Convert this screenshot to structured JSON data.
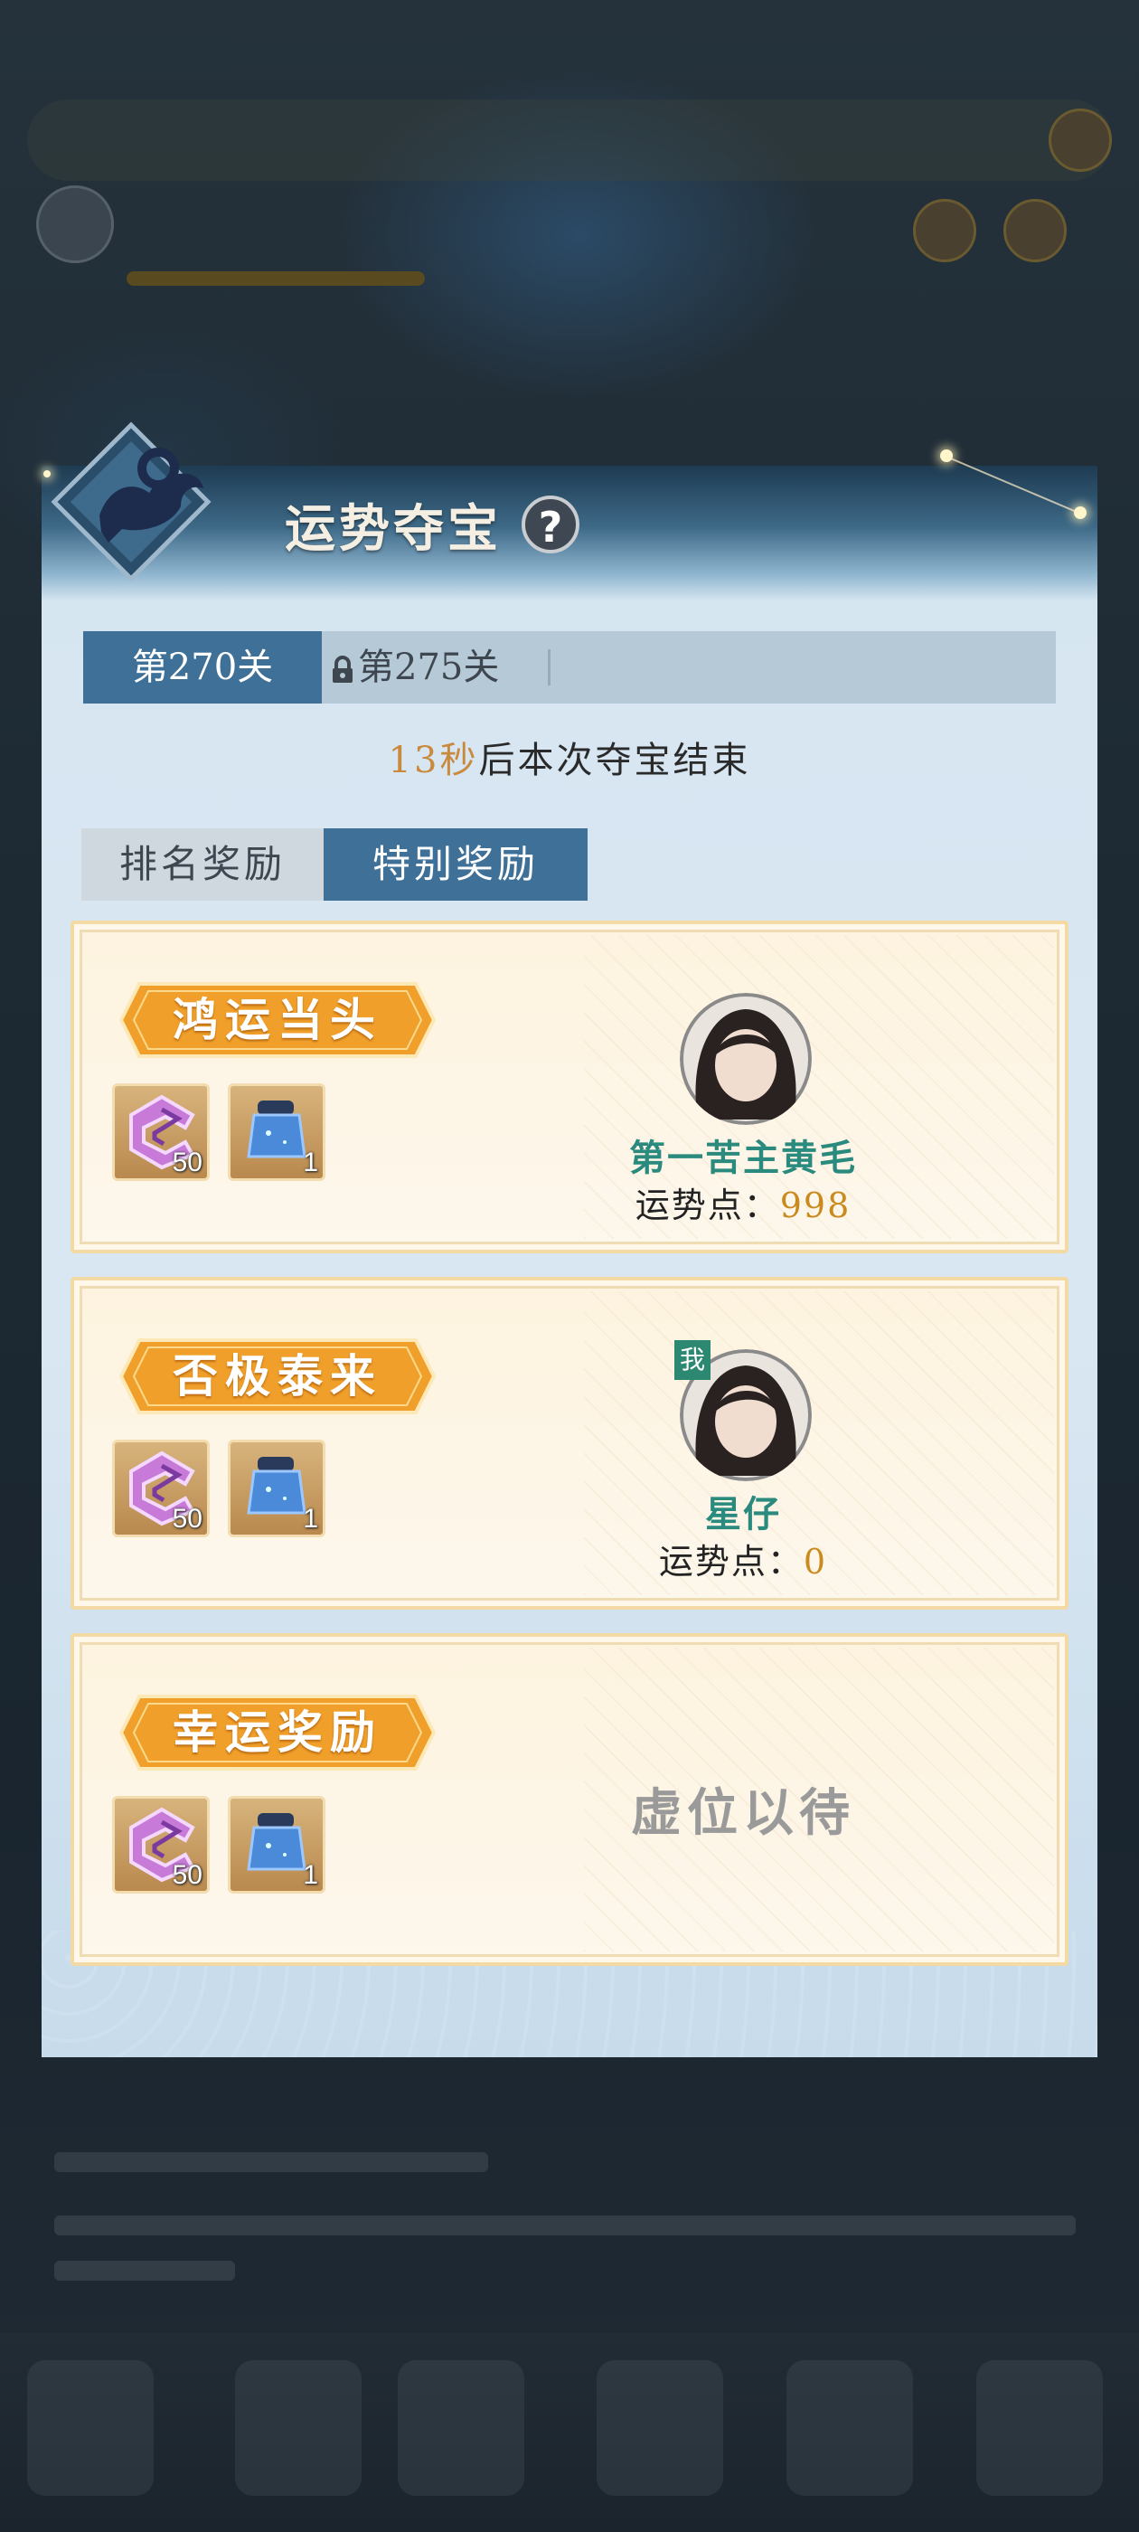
{
  "panel": {
    "title": "运势夺宝",
    "help_label": "?"
  },
  "levels": [
    {
      "label": "第270关",
      "state": "active"
    },
    {
      "label": "第275关",
      "state": "locked"
    }
  ],
  "countdown": {
    "value": "13秒",
    "suffix": "后本次夺宝结束"
  },
  "reward_tabs": [
    {
      "label": "排名奖励",
      "active": false
    },
    {
      "label": "特别奖励",
      "active": true
    }
  ],
  "reward_cards": [
    {
      "banner": "鸿运当头",
      "items": [
        {
          "icon": "purple-crystal-icon",
          "count": "50"
        },
        {
          "icon": "blue-scroll-icon",
          "count": "1"
        }
      ],
      "player": {
        "name": "第一苦主黄毛",
        "points_label": "运势点：",
        "points": "998",
        "is_me": false
      }
    },
    {
      "banner": "否极泰来",
      "items": [
        {
          "icon": "purple-crystal-icon",
          "count": "50"
        },
        {
          "icon": "blue-scroll-icon",
          "count": "1"
        }
      ],
      "player": {
        "name": "星仔",
        "points_label": "运势点：",
        "points": "0",
        "is_me": true,
        "me_badge": "我"
      }
    },
    {
      "banner": "幸运奖励",
      "items": [
        {
          "icon": "purple-crystal-icon",
          "count": "50"
        },
        {
          "icon": "blue-scroll-icon",
          "count": "1"
        }
      ],
      "vacant_text": "虚位以待"
    }
  ],
  "colors": {
    "accent_blue": "#3f7198",
    "banner_orange": "#f0a02a",
    "name_teal": "#2a8a7e",
    "points_gold": "#c98a1e",
    "countdown_gold": "#c98a3e"
  }
}
